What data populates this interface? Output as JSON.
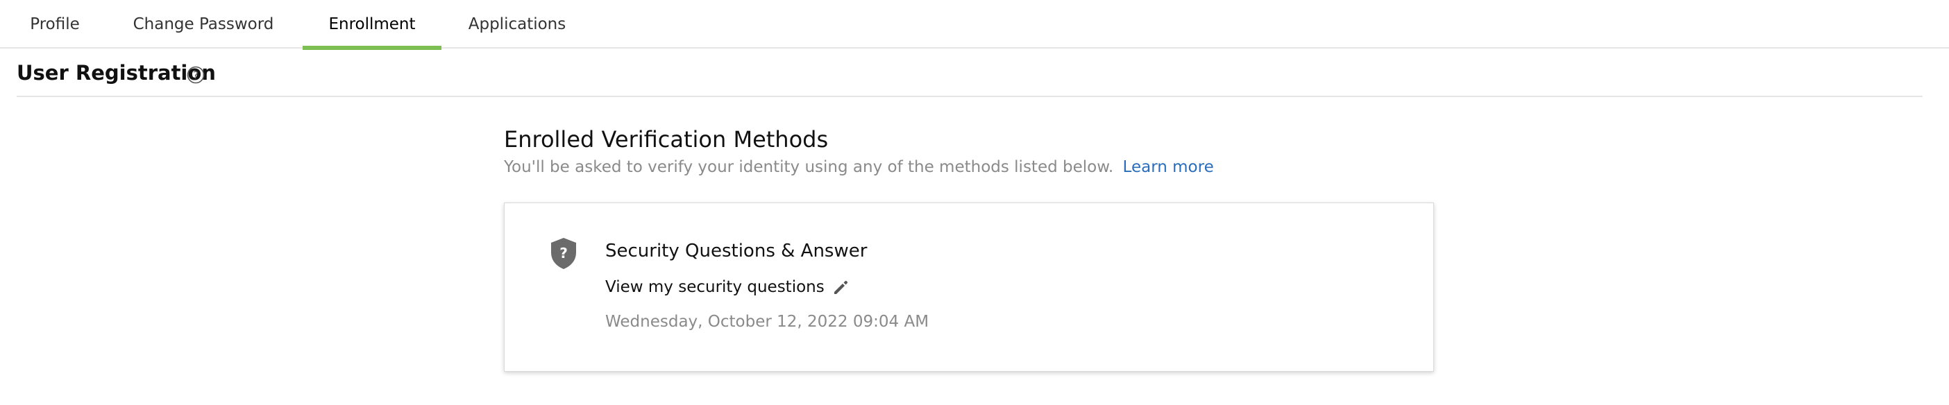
{
  "tabs": [
    {
      "label": "Profile",
      "active": false
    },
    {
      "label": "Change Password",
      "active": false
    },
    {
      "label": "Enrollment",
      "active": true
    },
    {
      "label": "Applications",
      "active": false
    }
  ],
  "section": {
    "title": "User Registration",
    "help_icon": "question-circle-icon"
  },
  "methods": {
    "title": "Enrolled Verification Methods",
    "description": "You'll be asked to verify your identity using any of the methods listed below.",
    "learn_more": "Learn more"
  },
  "card": {
    "icon": "shield-question-icon",
    "title": "Security Questions & Answer",
    "link": "View my security questions",
    "edit_icon": "pencil-icon",
    "date": "Wednesday, October 12, 2022 09:04 AM"
  },
  "colors": {
    "accent": "#7dbf53",
    "link": "#2a6ebb",
    "muted_text": "#8a8a8a",
    "border": "#e6e6e6"
  }
}
